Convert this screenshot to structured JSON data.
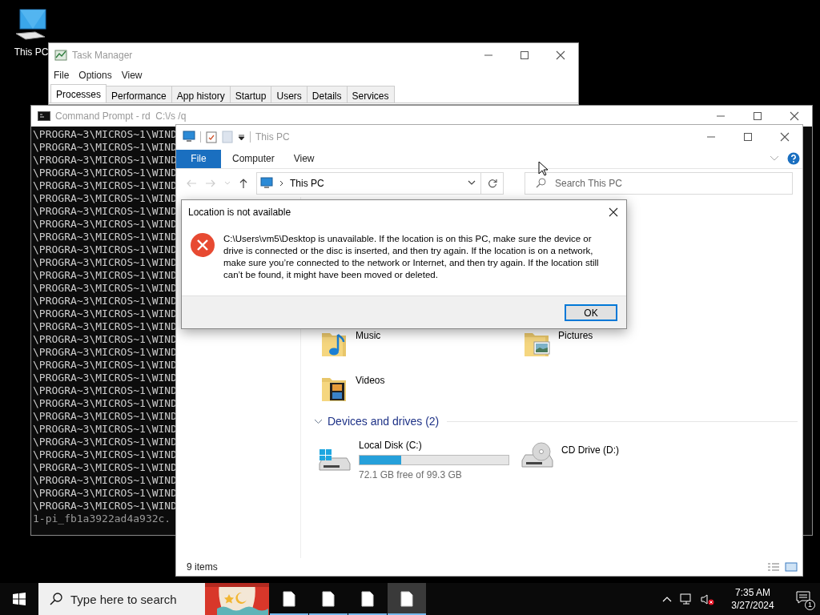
{
  "desktop_icons": [
    {
      "label": "This PC"
    }
  ],
  "task_manager": {
    "title": "Task Manager",
    "menu": [
      "File",
      "Options",
      "View"
    ],
    "tabs": [
      {
        "label": "Processes",
        "selected": true
      },
      {
        "label": "Performance",
        "selected": false
      },
      {
        "label": "App history",
        "selected": false
      },
      {
        "label": "Startup",
        "selected": false
      },
      {
        "label": "Users",
        "selected": false
      },
      {
        "label": "Details",
        "selected": false
      },
      {
        "label": "Services",
        "selected": false
      }
    ]
  },
  "command_prompt": {
    "title": "Command Prompt - rd  C:\\/s /q",
    "lines": [
      "\\PROGRA~3\\MICROS~1\\WIND",
      "\\PROGRA~3\\MICROS~1\\WIND",
      "\\PROGRA~3\\MICROS~1\\WIND",
      "\\PROGRA~3\\MICROS~1\\WIND",
      "\\PROGRA~3\\MICROS~1\\WIND",
      "\\PROGRA~3\\MICROS~1\\WIND",
      "\\PROGRA~3\\MICROS~1\\WIND",
      "\\PROGRA~3\\MICROS~1\\WIND",
      "\\PROGRA~3\\MICROS~1\\WIND",
      "\\PROGRA~3\\MICROS~1\\WIND",
      "\\PROGRA~3\\MICROS~1\\WIND",
      "\\PROGRA~3\\MICROS~1\\WIND",
      "\\PROGRA~3\\MICROS~1\\WIND",
      "\\PROGRA~3\\MICROS~1\\WIND",
      "\\PROGRA~3\\MICROS~1\\WIND",
      "\\PROGRA~3\\MICROS~1\\WIND",
      "\\PROGRA~3\\MICROS~1\\WIND",
      "\\PROGRA~3\\MICROS~1\\WIND",
      "\\PROGRA~3\\MICROS~1\\WIND",
      "\\PROGRA~3\\MICROS~1\\WIND",
      "\\PROGRA~3\\MICROS~1\\WIND",
      "\\PROGRA~3\\MICROS~1\\WIND",
      "\\PROGRA~3\\MICROS~1\\WIND",
      "\\PROGRA~3\\MICROS~1\\WIND",
      "\\PROGRA~3\\MICROS~1\\WIND",
      "\\PROGRA~3\\MICROS~1\\WIND",
      "\\PROGRA~3\\MICROS~1\\WIND",
      "\\PROGRA~3\\MICROS~1\\WIND",
      "\\PROGRA~3\\MICROS~1\\WIND",
      "\\PROGRA~3\\MICROS~1\\WIND",
      "1-pi_fb1a3922ad4a932c."
    ]
  },
  "explorer": {
    "title": "This PC",
    "file_tab": "File",
    "ribbon_tabs": [
      "Computer",
      "View"
    ],
    "address": "This PC",
    "search": {
      "placeholder": "Search This PC"
    },
    "folders": [
      {
        "name": "Music",
        "kind": "music"
      },
      {
        "name": "Pictures",
        "kind": "pictures"
      },
      {
        "name": "Videos",
        "kind": "videos"
      }
    ],
    "drives_header": "Devices and drives (2)",
    "drives": [
      {
        "name": "Local Disk (C:)",
        "kind": "disk",
        "level": 0.28,
        "free": "72.1 GB free of 99.3 GB"
      },
      {
        "name": "CD Drive (D:)",
        "kind": "cd"
      }
    ],
    "status": "9 items"
  },
  "dialog": {
    "title": "Location is not available",
    "message": "C:\\Users\\vm5\\Desktop is unavailable. If the location is on this PC, make sure the device or drive is connected or the disc is inserted, and then try again. If the location is on a network, make sure you’re connected to the network or Internet, and then try again. If the location still can’t be found, it might have been moved or deleted.",
    "button": "OK"
  },
  "taskbar": {
    "search_placeholder": "Type here to search",
    "apps": [
      {
        "kind": "document",
        "active": false
      },
      {
        "kind": "document",
        "active": false
      },
      {
        "kind": "document",
        "active": false
      },
      {
        "kind": "document",
        "active": true
      }
    ],
    "time": "7:35 AM",
    "date": "3/27/2024",
    "notifications": "1"
  }
}
